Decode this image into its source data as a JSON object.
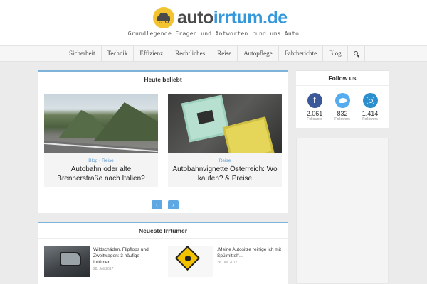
{
  "header": {
    "logo_part1": "auto",
    "logo_part2": "irrtum.de",
    "tagline": "Grundlegende Fragen und Antworten rund ums Auto",
    "logo_icon": "car-icon",
    "brand_color": "#3498db",
    "badge_color": "#f4c430"
  },
  "nav": {
    "items": [
      "Sicherheit",
      "Technik",
      "Effizienz",
      "Rechtliches",
      "Reise",
      "Autopflege",
      "Fahrberichte",
      "Blog"
    ],
    "search_icon": "search-icon"
  },
  "popular": {
    "title": "Heute beliebt",
    "cards": [
      {
        "category": "Blog • Reise",
        "title": "Autobahn oder alte Brennerstraße nach Italien?"
      },
      {
        "category": "Reise",
        "title": "Autobahnvignette Österreich: Wo kaufen? & Preise"
      }
    ],
    "prev_label": "‹",
    "next_label": "›"
  },
  "follow": {
    "title": "Follow us",
    "networks": [
      {
        "icon": "facebook-icon",
        "glyph": "f",
        "count": "2.061",
        "label": "Followers",
        "color": "#3b5998"
      },
      {
        "icon": "twitter-icon",
        "count": "832",
        "label": "Followers",
        "color": "#55acee"
      },
      {
        "icon": "instagram-icon",
        "count": "1.414",
        "label": "Followers",
        "color": "#2a8fcc"
      }
    ]
  },
  "newest": {
    "title": "Neueste Irrtümer",
    "posts": [
      {
        "title": "Wildschäden, Flipflops und Zweitwagen: 3 häufige Irrtümer…",
        "date": "28. Juli 2017"
      },
      {
        "title": "„Meine Autositze reinige ich mit Spülmittel“…",
        "date": "26. Juli 2017"
      }
    ]
  }
}
